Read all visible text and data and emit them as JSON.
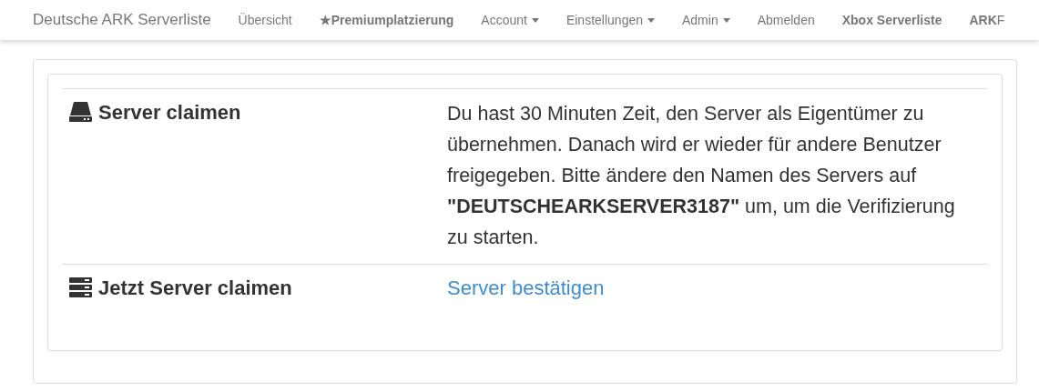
{
  "navbar": {
    "brand": "Deutsche ARK Serverliste",
    "items": [
      {
        "label": "Übersicht",
        "kind": "plain"
      },
      {
        "label": "★Premiumplatzierung",
        "kind": "bold"
      },
      {
        "label": "Account",
        "kind": "dropdown"
      },
      {
        "label": "Einstellungen",
        "kind": "dropdown"
      },
      {
        "label": "Admin",
        "kind": "dropdown"
      },
      {
        "label": "Abmelden",
        "kind": "plain"
      },
      {
        "label": "Xbox Serverliste",
        "kind": "bold"
      },
      {
        "label": "**ARK**F",
        "kind": "plain"
      }
    ]
  },
  "rows": [
    {
      "title": "Server claimen",
      "kind": "text",
      "content": "Du hast 30 Minuten Zeit, den Server als Eigentümer zu übernehmen. Danach wird er wieder für andere Benutzer freigegeben. Bitte ändere den Namen des Servers auf **\"DEUTSCHEARKSERVER3187\"** um, um die Verifizierung zu starten."
    },
    {
      "title": "Jetzt Server claimen",
      "kind": "link",
      "content": "Server bestätigen"
    }
  ]
}
